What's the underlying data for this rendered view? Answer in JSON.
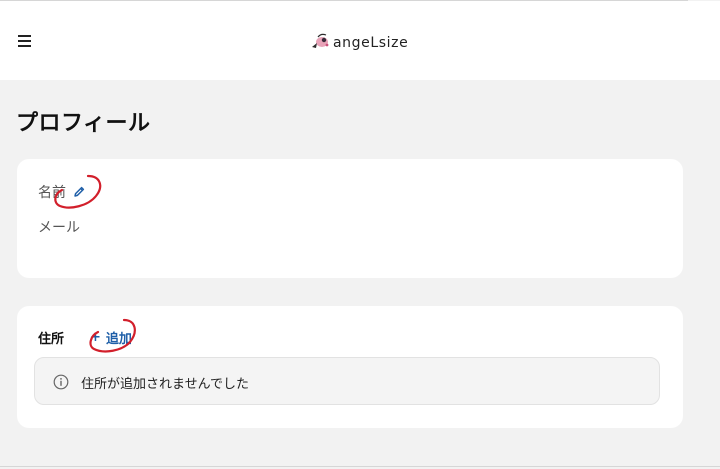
{
  "header": {
    "logo_text": "angeLsize",
    "menu_icon": "hamburger-menu-icon",
    "logo_icon": "angel-logo-icon"
  },
  "page": {
    "title": "プロフィール"
  },
  "profile_card": {
    "name_label": "名前",
    "edit_icon": "pencil-icon",
    "email_label": "メール"
  },
  "address_card": {
    "label": "住所",
    "add_plus": "+",
    "add_label": "追加",
    "notice_icon": "info-icon",
    "empty_notice": "住所が追加されませんでした"
  },
  "colors": {
    "background": "#f2f2f2",
    "card": "#ffffff",
    "link": "#1f5fa8",
    "annotation": "#d21f2b"
  }
}
